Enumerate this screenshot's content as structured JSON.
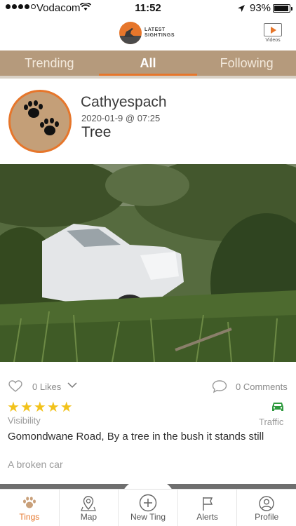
{
  "status_bar": {
    "carrier": "Vodacom",
    "time": "11:52",
    "battery": "93%"
  },
  "header": {
    "logo_line1": "LATEST",
    "logo_line2": "SIGHTINGS",
    "videos_label": "Videos"
  },
  "tabs": [
    {
      "label": "Trending",
      "active": false
    },
    {
      "label": "All",
      "active": true
    },
    {
      "label": "Following",
      "active": false
    }
  ],
  "post": {
    "username": "Cathyespach",
    "date": "2020-01-9 @ 07:25",
    "title": "Tree",
    "likes": "0 Likes",
    "comments": "0 Comments",
    "visibility_label": "Visibility",
    "visibility_stars": 5,
    "category": "Traffic",
    "location": "Gomondwane Road, By a tree in the bush it stands still",
    "description": "A broken car"
  },
  "bottom_nav": [
    {
      "label": "Tings",
      "icon": "paw-icon",
      "active": true
    },
    {
      "label": "Map",
      "icon": "map-pin-icon",
      "active": false
    },
    {
      "label": "New Ting",
      "icon": "plus-circle-icon",
      "active": false
    },
    {
      "label": "Alerts",
      "icon": "flag-icon",
      "active": false
    },
    {
      "label": "Profile",
      "icon": "user-icon",
      "active": false
    }
  ],
  "colors": {
    "accent": "#e6762b",
    "tab_bar": "#b59a7c",
    "star": "#f2c21a",
    "traffic": "#2e9a3e"
  }
}
